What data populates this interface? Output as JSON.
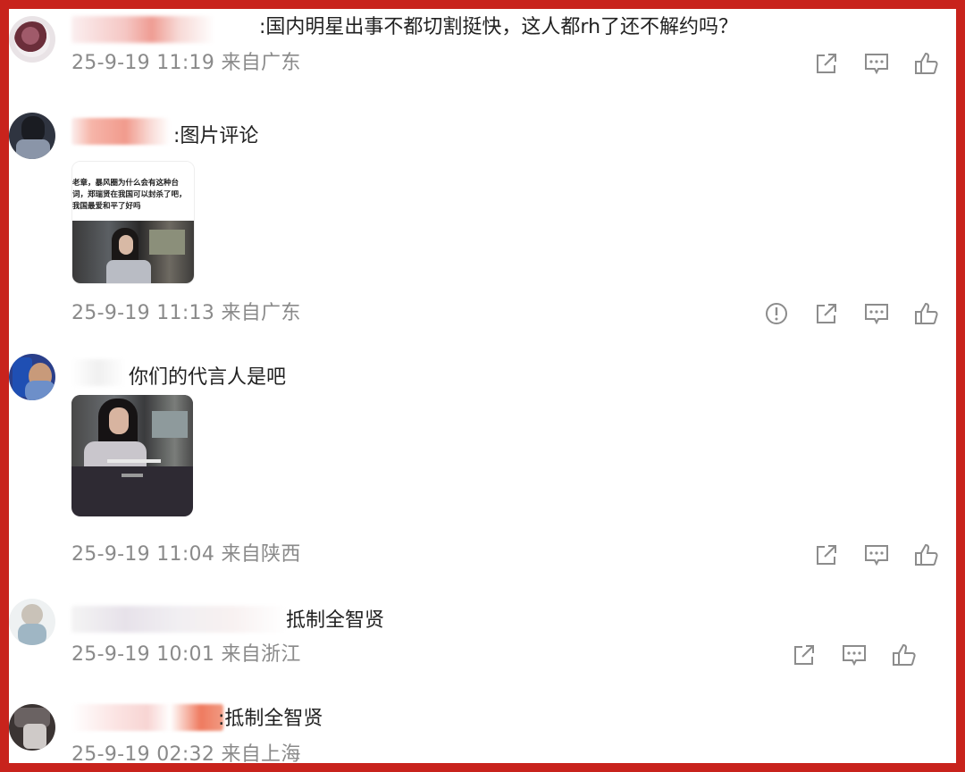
{
  "comments": [
    {
      "text": ":国内明星出事不都切割挺快，这人都rh了还不解约吗？",
      "time": "25-9-19 11:19",
      "location": "来自广东",
      "actions": [
        "share-icon",
        "comment-icon",
        "like-icon"
      ]
    },
    {
      "text": ":图片评论",
      "time": "25-9-19 11:13",
      "location": "来自广东",
      "image": {
        "caption_lines": [
          "老章，暴风圈为什么会有这种台",
          "词，郑瑞贤在我国可以封杀了吧，",
          "我国最爱和平了好吗"
        ]
      },
      "actions": [
        "report-icon",
        "share-icon",
        "comment-icon",
        "like-icon"
      ]
    },
    {
      "text": "你们的代言人是吧",
      "time": "25-9-19 11:04",
      "location": "来自陕西",
      "actions": [
        "share-icon",
        "comment-icon",
        "like-icon"
      ]
    },
    {
      "text": "抵制全智贤",
      "time": "25-9-19 10:01",
      "location": "来自浙江",
      "actions": [
        "share-icon",
        "comment-icon",
        "like-icon"
      ]
    },
    {
      "text": ":抵制全智贤",
      "time": "25-9-19 02:32",
      "location": "来自上海",
      "actions": []
    }
  ],
  "colors": {
    "frame": "#c8231c",
    "meta_text": "#8a8a8a",
    "body_text": "#222222",
    "icon": "#8c8c8c"
  }
}
